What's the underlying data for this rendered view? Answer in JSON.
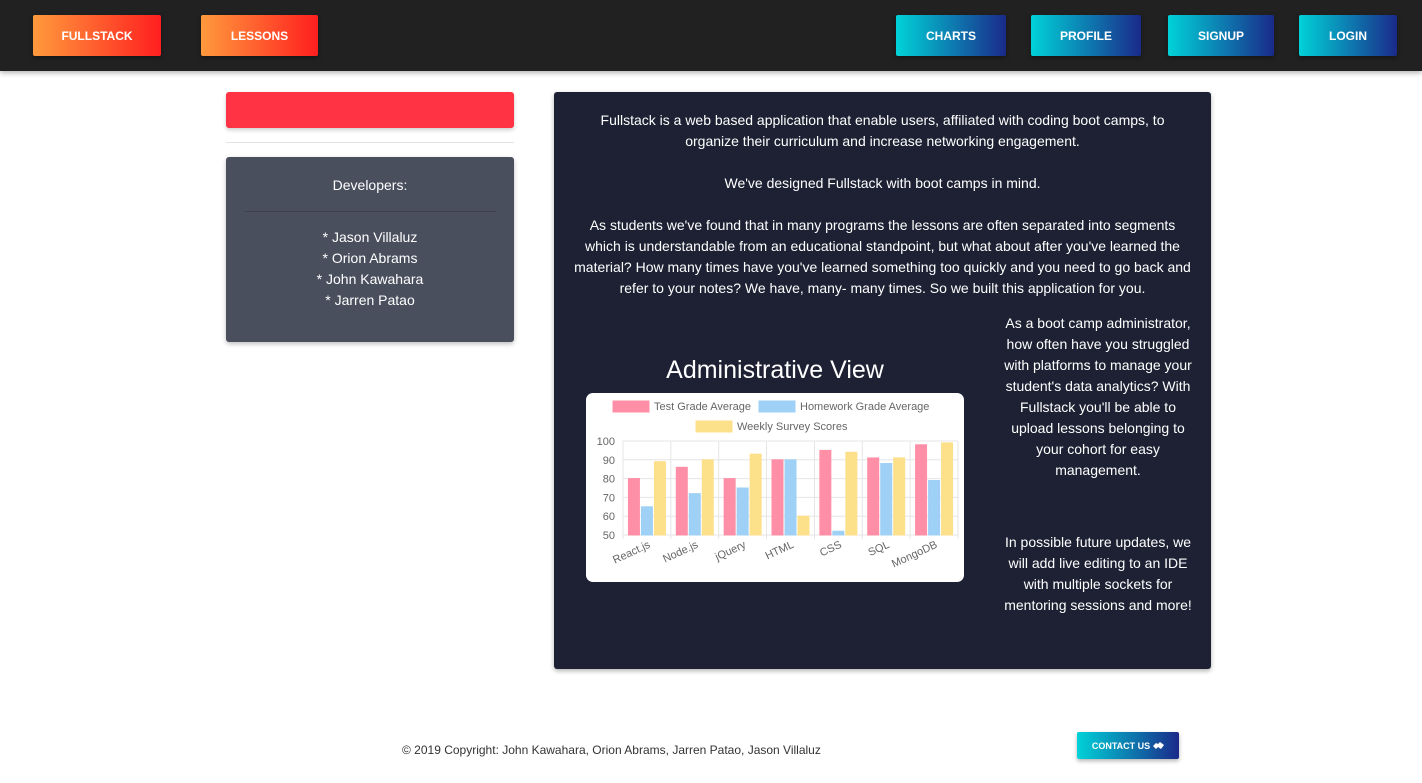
{
  "nav": {
    "left": [
      {
        "label": "FULLSTACK"
      },
      {
        "label": "LESSONS"
      }
    ],
    "right": [
      {
        "label": "CHARTS"
      },
      {
        "label": "PROFILE"
      },
      {
        "label": "SIGNUP"
      },
      {
        "label": "LOGIN"
      }
    ]
  },
  "developers": {
    "title": "Developers:",
    "names": [
      "* Jason Villaluz",
      "* Orion Abrams",
      "* John Kawahara",
      "* Jarren Patao"
    ]
  },
  "about": {
    "p1": "Fullstack is a web based application that enable users, affiliated with coding boot camps, to organize their curriculum and increase networking engagement.",
    "p2": "We've designed Fullstack with boot camps in mind.",
    "p3": "As students we've found that in many programs the lessons are often separated into segments which is understandable from an educational standpoint, but what about after you've learned the material? How many times have you've learned something too quickly and you need to go back and refer to your notes? We have, many- many times. So we built this application for you.",
    "side1": "As a boot camp administrator, how often have you struggled with platforms to manage your student's data analytics? With Fullstack you'll be able to upload lessons belonging to your cohort for easy management.",
    "side2": "In possible future updates, we will add live editing to an IDE with multiple sockets for mentoring sessions and more!",
    "chart_title": "Administrative View"
  },
  "chart_data": {
    "type": "bar",
    "categories": [
      "React.js",
      "Node.js",
      "jQuery",
      "HTML",
      "CSS",
      "SQL",
      "MongoDB"
    ],
    "series": [
      {
        "name": "Test Grade Average",
        "color": "#ff8fa6",
        "values": [
          80,
          86,
          80,
          90,
          95,
          91,
          98
        ]
      },
      {
        "name": "Homework Grade Average",
        "color": "#9fd0f5",
        "values": [
          65,
          72,
          75,
          90,
          52,
          88,
          79
        ]
      },
      {
        "name": "Weekly Survey Scores",
        "color": "#fde08a",
        "values": [
          89,
          90,
          93,
          60,
          94,
          91,
          99
        ]
      }
    ],
    "ylim": [
      50,
      100
    ],
    "yticks": [
      100,
      90,
      80,
      70,
      60,
      50
    ],
    "grid": true,
    "legend": "top"
  },
  "footer": {
    "copyright": "© 2019 Copyright: John Kawahara, Orion Abrams, Jarren Patao, Jason Villaluz",
    "contact": "CONTACT US",
    "contact_icon": "handshake-icon"
  }
}
